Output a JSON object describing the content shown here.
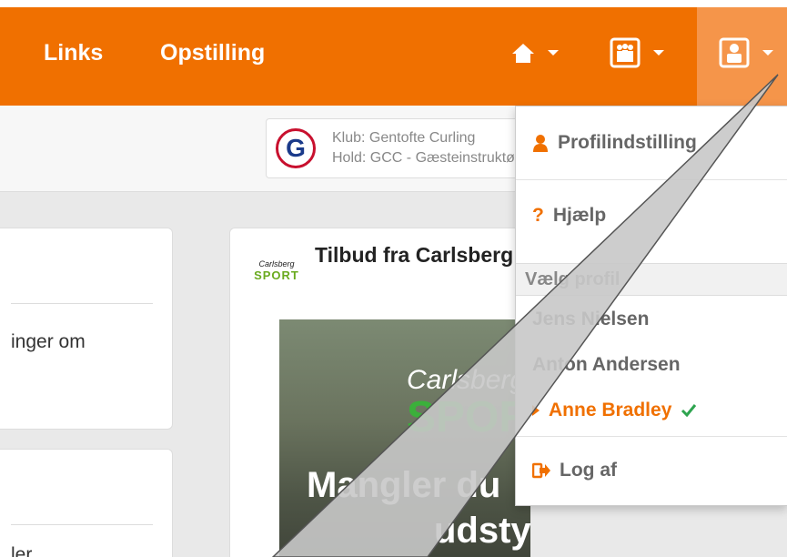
{
  "nav": {
    "links_label": "Links",
    "opstilling_label": "Opstilling"
  },
  "club": {
    "line1": "Klub: Gentofte Curling",
    "line2": "Hold: GCC - Gæsteinstruktør"
  },
  "cards": {
    "card1_text": "inger om",
    "card2_text": "ler",
    "card3_title": "Tilbud fra Carlsberg",
    "sport_logo_top": "Carlsberg",
    "sport_logo_bottom": "SPORT",
    "ad_line1": "Carlsberg",
    "ad_line2": "SPORT",
    "ad_line3": "Mangler du",
    "ad_line4": "udstyr?"
  },
  "dropdown": {
    "profile_settings": "Profilindstilling",
    "help": "Hjælp",
    "select_profile_header": "Vælg profil",
    "profiles": [
      "Jens Nielsen",
      "Anton Andersen",
      "Anne Bradley"
    ],
    "logout": "Log af"
  },
  "colors": {
    "brand_orange": "#f07000",
    "active_user_bg": "#f5954a",
    "check_green": "#2ea44f"
  }
}
